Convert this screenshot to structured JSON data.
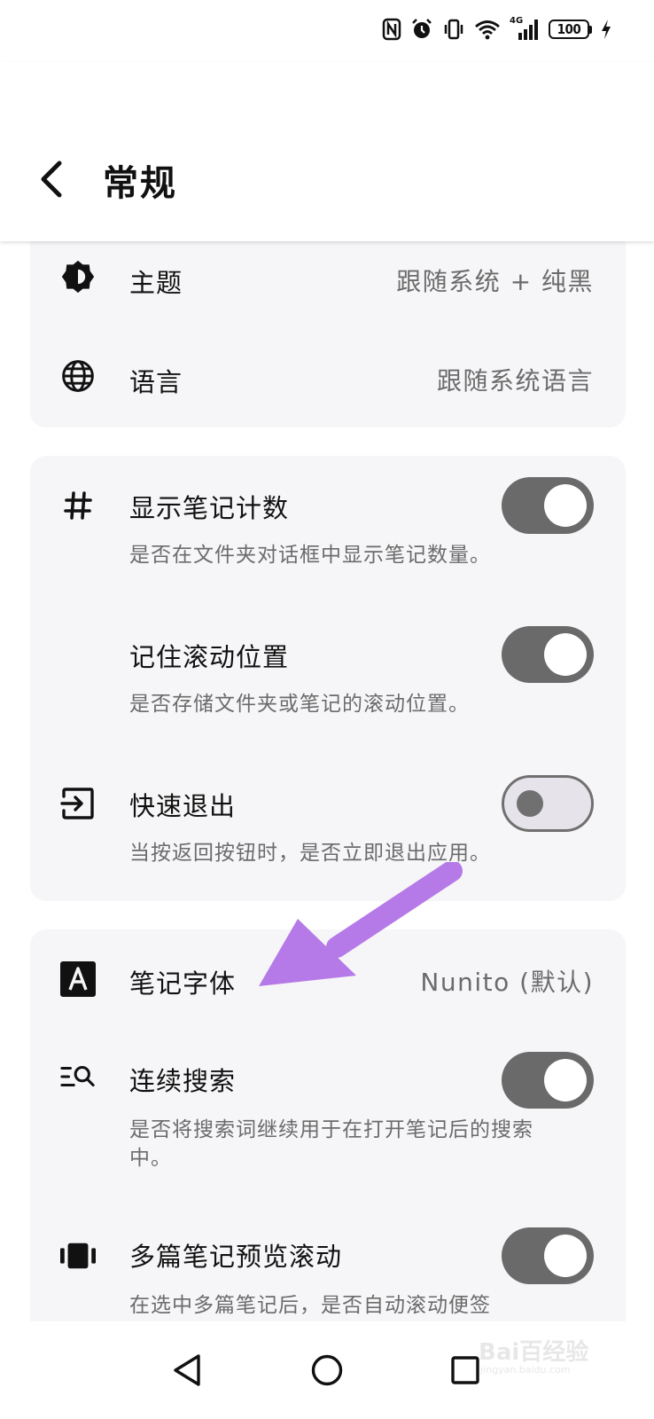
{
  "status_bar": {
    "network_label": "4G",
    "battery": "100"
  },
  "header": {
    "title": "常规"
  },
  "cards": {
    "appearance": {
      "theme": {
        "label": "主题",
        "value": "跟随系统 + 纯黑"
      },
      "language": {
        "label": "语言",
        "value": "跟随系统语言"
      }
    },
    "folders": {
      "show_count": {
        "label": "显示笔记计数",
        "desc": "是否在文件夹对话框中显示笔记数量。",
        "enabled": true
      },
      "remember_scroll": {
        "label": "记住滚动位置",
        "desc": "是否存储文件夹或笔记的滚动位置。",
        "enabled": true
      },
      "quick_exit": {
        "label": "快速退出",
        "desc": "当按返回按钮时，是否立即退出应用。",
        "enabled": false
      }
    },
    "notes": {
      "font": {
        "label": "笔记字体",
        "value": "Nunito (默认)"
      },
      "continuous_search": {
        "label": "连续搜索",
        "desc": "是否将搜索词继续用于在打开笔记后的搜索中。",
        "enabled": true
      },
      "multi_preview_scroll": {
        "label": "多篇笔记预览滚动",
        "desc": "在选中多篇笔记后，是否自动滚动便签",
        "enabled": true
      }
    }
  },
  "colors": {
    "annotation_arrow": "#b57ae8",
    "toggle_on": "#6a6a6a",
    "card_bg": "#f6f6f8"
  },
  "watermark": {
    "text": "Bai百经验",
    "sub": "jingyan.baidu.com"
  }
}
